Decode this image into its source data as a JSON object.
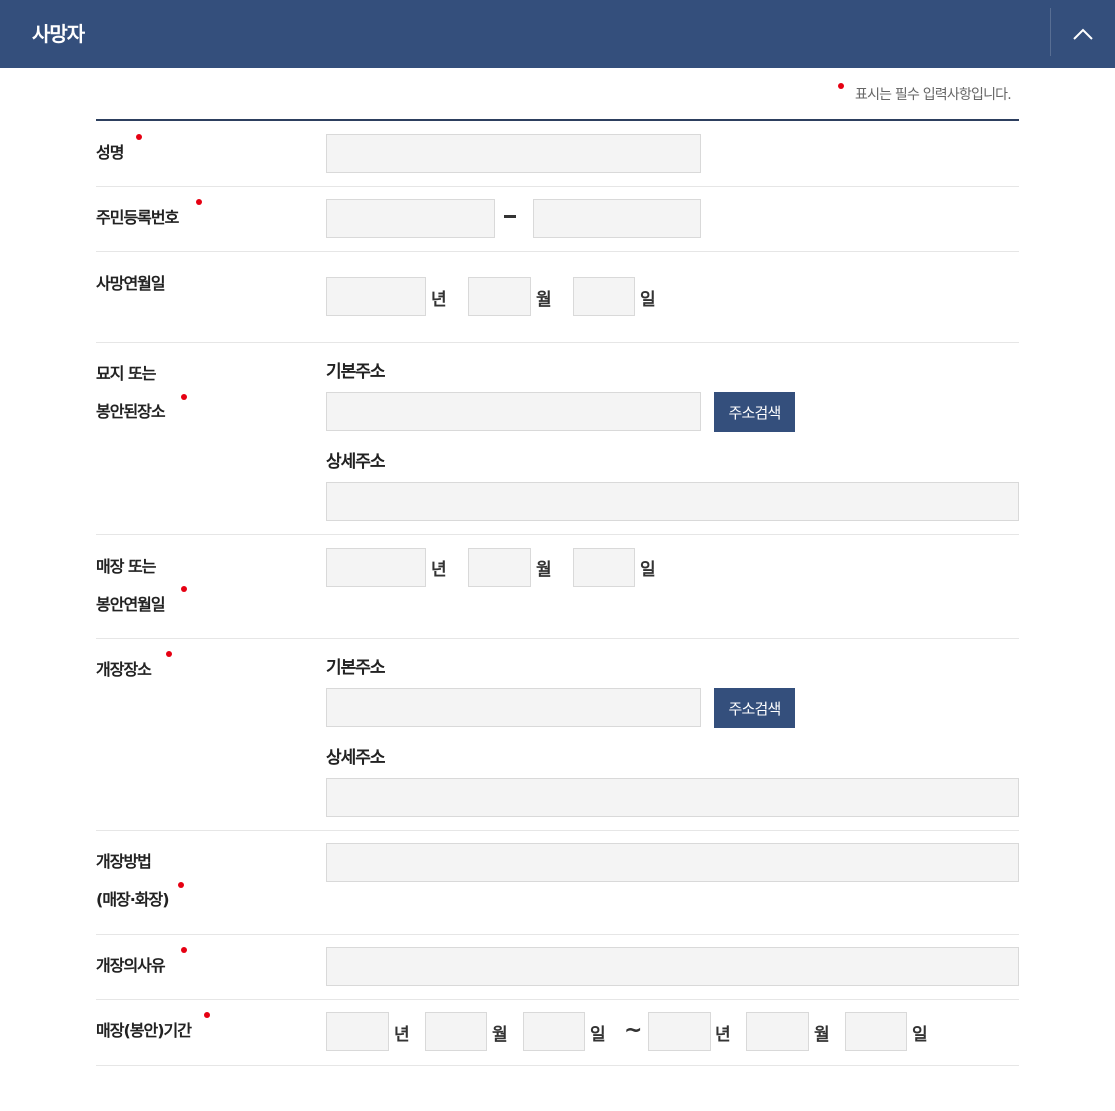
{
  "header": {
    "title": "사망자"
  },
  "required_note": "표시는 필수 입력사항입니다.",
  "fields": {
    "name": {
      "label": "성명"
    },
    "rrn": {
      "label": "주민등록번호"
    },
    "death_date": {
      "label": "사망연월일"
    },
    "burial_place": {
      "label_line1": "묘지 또는",
      "label_line2": "봉안된장소"
    },
    "burial_date": {
      "label_line1": "매장 또는",
      "label_line2": "봉안연월일"
    },
    "reburial_place": {
      "label": "개장장소"
    },
    "reburial_method": {
      "label_line1": "개장방법",
      "label_line2": "(매장·화장)"
    },
    "reburial_reason": {
      "label": "개장의사유"
    },
    "burial_period": {
      "label": "매장(봉안)기간"
    }
  },
  "address": {
    "basic_label": "기본주소",
    "detail_label": "상세주소",
    "search_button": "주소검색"
  },
  "units": {
    "year": "년",
    "month": "월",
    "day": "일"
  },
  "range_separator": "~",
  "colors": {
    "header_bg": "#344f7c",
    "required_dot": "#e60012",
    "input_bg": "#f4f4f4"
  },
  "icons": {
    "collapse": "chevron-up-icon"
  }
}
